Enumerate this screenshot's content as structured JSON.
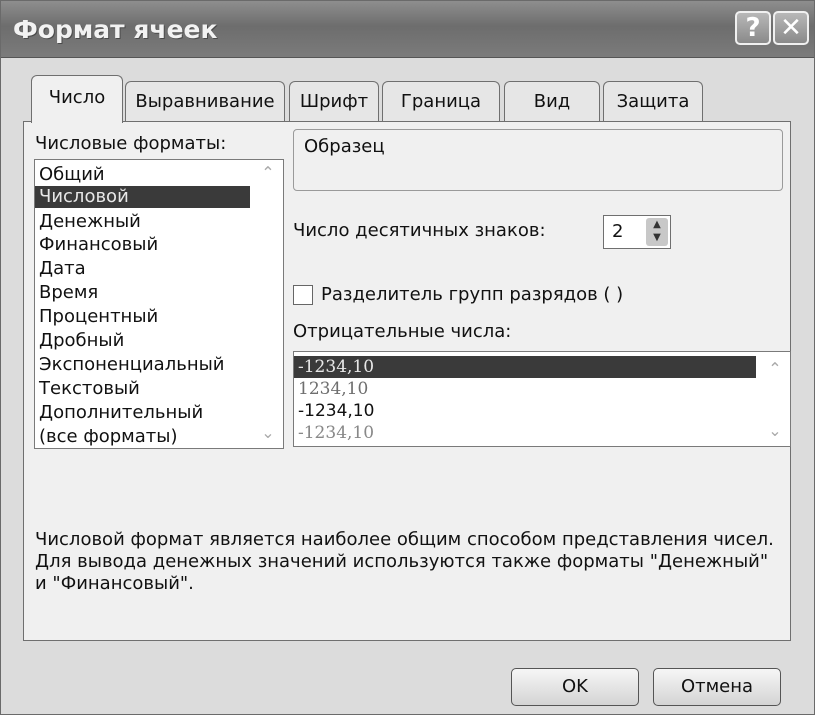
{
  "window": {
    "title": "Формат ячеек",
    "help_glyph": "?",
    "close_glyph": "✕"
  },
  "tabs": [
    {
      "label": "Число",
      "active": true
    },
    {
      "label": "Выравнивание"
    },
    {
      "label": "Шрифт"
    },
    {
      "label": "Граница"
    },
    {
      "label": "Вид"
    },
    {
      "label": "Защита"
    }
  ],
  "categories": {
    "label": "Числовые форматы:",
    "selected": "Числовой",
    "items": [
      "Общий",
      "Числовой",
      "Денежный",
      "Финансовый",
      "Дата",
      "Время",
      "Процентный",
      "Дробный",
      "Экспоненциальный",
      "Текстовый",
      "Дополнительный",
      "(все форматы)"
    ]
  },
  "sample": {
    "label": "Образец",
    "value": ""
  },
  "decimals": {
    "label": "Число десятичных знаков:",
    "value": "2"
  },
  "separator": {
    "label": "Разделитель групп разрядов ( )",
    "checked": false
  },
  "negative": {
    "label": "Отрицательные числа:",
    "items": [
      "-1234,10",
      "1234,10",
      "-1234,10",
      "-1234,10"
    ],
    "selected_index": 0
  },
  "description": "Числовой формат является наиболее общим способом представления чисел. Для вывода денежных значений используются также форматы \"Денежный\" и \"Финансовый\".",
  "buttons": {
    "ok": "OK",
    "cancel": "Отмена"
  }
}
